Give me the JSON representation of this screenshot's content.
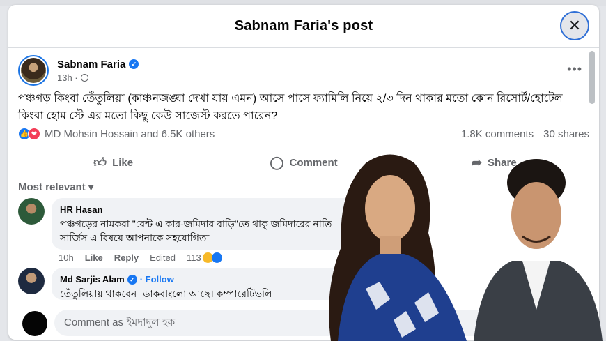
{
  "modal": {
    "title": "Sabnam Faria's post",
    "close_glyph": "✕"
  },
  "post": {
    "author": "Sabnam Faria",
    "time": "13h ·",
    "more": "•••",
    "text": "পঞ্চগড় কিংবা তেঁতুলিয়া (কাঞ্চনজঙ্ঘা দেখা যায় এমন) আসে পাসে ফ্যামিলি নিয়ে ২/৩ দিন থাকার মতো কোন রিসোর্ট/হোটেল কিংবা হোম স্টে এর মতো কিছু কেউ সাজেস্ট করতে পারেন?",
    "reactions_text": "MD Mohsin Hossain and 6.5K others",
    "comments_count": "1.8K comments",
    "shares_count": "30 shares"
  },
  "actions": {
    "like": "Like",
    "comment": "Comment",
    "share": "Share"
  },
  "sort_label": "Most relevant",
  "comments": [
    {
      "name": "HR Hasan",
      "text": "পঞ্চগড়ের নামকরা \"রেন্ট এ কার-জমিদার বাড়ি\"তে থাকু জমিদারের নাতি সার্জিস এ বিষয়ে আপনাকে সহযোগিতা",
      "time": "10h",
      "like": "Like",
      "reply": "Reply",
      "edited": "Edited",
      "reaction_count": "113"
    },
    {
      "name": "Md Sarjis Alam",
      "follow": "· Follow",
      "text": "তেঁতুলিয়ায় থাকবেন। ডাকবাংলো আছে। কম্পারেটিভলি"
    }
  ],
  "composer": {
    "placeholder": "Comment as ইমদাদুল হক"
  },
  "colors": {
    "accent": "#1877f2",
    "love": "#f33e58",
    "overlay_saree": "#1f3f8f",
    "overlay_suit": "#3a3f46"
  },
  "icons": [
    "verified-icon",
    "globe-icon",
    "like-icon",
    "comment-icon",
    "share-icon",
    "chevron-down-icon",
    "close-icon"
  ]
}
